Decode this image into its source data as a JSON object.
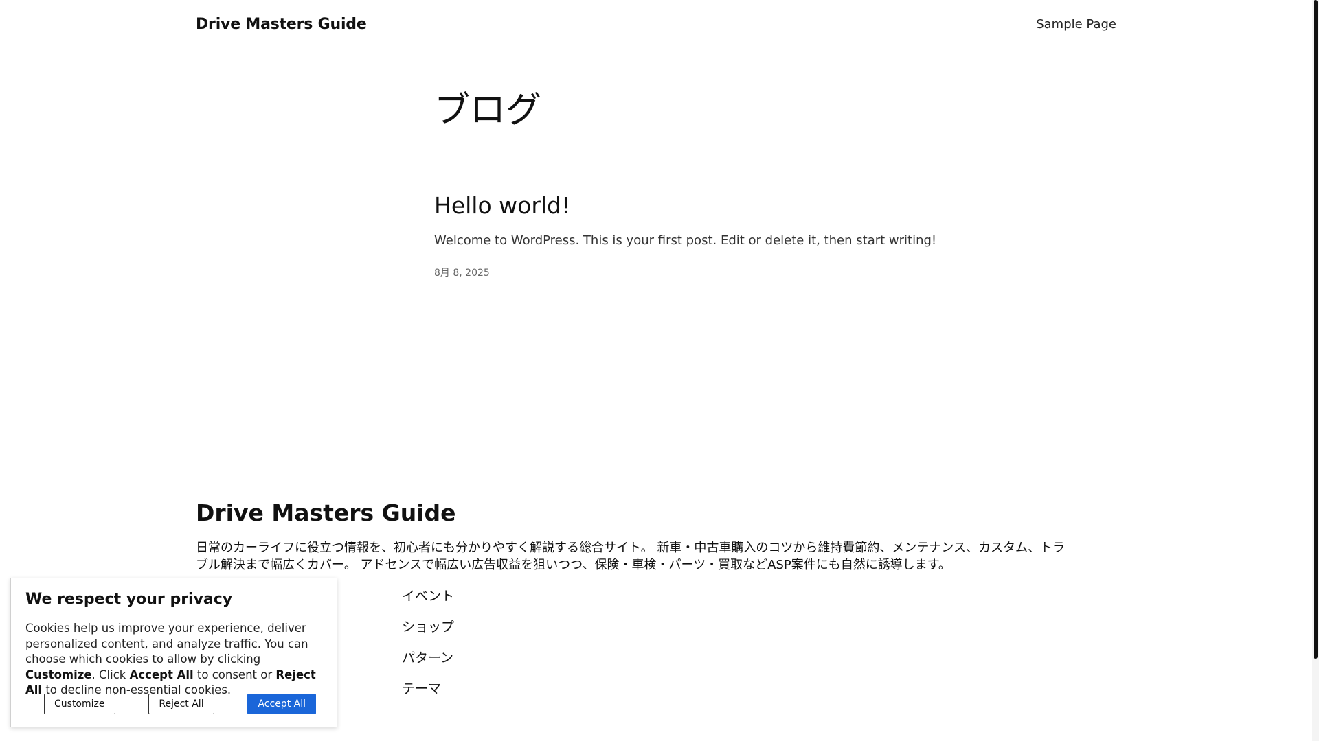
{
  "header": {
    "site_title": "Drive Masters Guide",
    "nav": [
      "Sample Page"
    ]
  },
  "main": {
    "page_title": "ブログ",
    "posts": [
      {
        "title": "Hello world!",
        "excerpt": "Welcome to WordPress. This is your first post. Edit or delete it, then start writing!",
        "date": "8月 8, 2025"
      }
    ]
  },
  "footer": {
    "title": "Drive Masters Guide",
    "description": "日常のカーライフに役立つ情報を、初心者にも分かりやすく解説する総合サイト。 新車・中古車購入のコツから維持費節約、メンテナンス、カスタム、トラブル解決まで幅広くカバー。 アドセンスで幅広い広告収益を狙いつつ、保険・車検・パーツ・買取などASP案件にも自然に誘導します。",
    "links": [
      "イベント",
      "ショップ",
      "パターン",
      "テーマ"
    ]
  },
  "cookie_banner": {
    "title": "We respect your privacy",
    "text_1": "Cookies help us improve your experience, deliver personalized content, and analyze traffic. You can choose which cookies to allow by clicking ",
    "customize_bold": "Customize",
    "text_2": ". Click ",
    "accept_bold": "Accept All",
    "text_3": " to consent or ",
    "reject_bold": "Reject All",
    "text_4": " to decline non-essential cookies.",
    "buttons": {
      "customize": "Customize",
      "reject": "Reject All",
      "accept": "Accept All"
    }
  },
  "colors": {
    "accent": "#1a66d9",
    "text": "#111111",
    "background": "#ffffff"
  }
}
